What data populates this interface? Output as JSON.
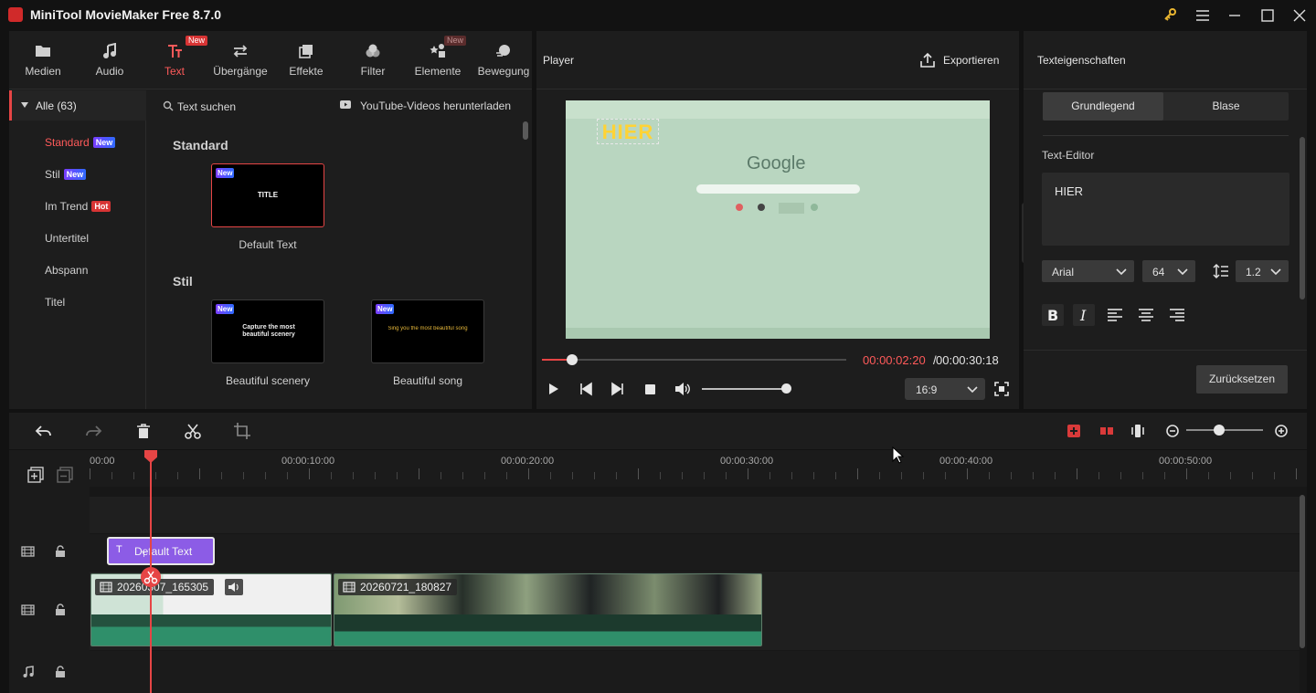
{
  "window": {
    "title": "MiniTool MovieMaker Free 8.7.0"
  },
  "media_tabs": [
    {
      "label": "Medien",
      "icon": "folder-icon"
    },
    {
      "label": "Audio",
      "icon": "music-note-icon"
    },
    {
      "label": "Text",
      "icon": "text-icon",
      "badge": "New",
      "active": true
    },
    {
      "label": "Übergänge",
      "icon": "transition-arrows-icon"
    },
    {
      "label": "Effekte",
      "icon": "effects-icon"
    },
    {
      "label": "Filter",
      "icon": "filter-icon"
    },
    {
      "label": "Elemente",
      "icon": "elements-icon",
      "badge": "New"
    },
    {
      "label": "Bewegung",
      "icon": "motion-icon"
    }
  ],
  "categories": {
    "all_label": "Alle (63)",
    "items": [
      {
        "label": "Standard",
        "badge": "New",
        "active": true
      },
      {
        "label": "Stil",
        "badge": "New"
      },
      {
        "label": "Im Trend",
        "badge": "Hot"
      },
      {
        "label": "Untertitel"
      },
      {
        "label": "Abspann"
      },
      {
        "label": "Titel"
      }
    ]
  },
  "text_library": {
    "search_label": "Text suchen",
    "youtube_label": "YouTube-Videos herunterladen",
    "sections": [
      {
        "title": "Standard",
        "items": [
          {
            "caption": "Default Text",
            "thumb_text": "TITLE",
            "badge": "New"
          }
        ]
      },
      {
        "title": "Stil",
        "items": [
          {
            "caption": "Beautiful scenery",
            "thumb_text": "Capture the most beautiful scenery",
            "badge": "New"
          },
          {
            "caption": "Beautiful song",
            "thumb_text": "Sing you the most beautiful song",
            "badge": "New"
          }
        ]
      }
    ]
  },
  "player": {
    "title": "Player",
    "export_label": "Exportieren",
    "overlay_text": "HIER",
    "preview_logo_text": "Google",
    "time_current": "00:00:02:20",
    "time_separator": " / ",
    "time_total": "00:00:30:18",
    "aspect_ratio": "16:9",
    "playback_progress": 0.1,
    "volume_level": 1.0
  },
  "properties": {
    "title": "Texteigenschaften",
    "tab_basic": "Grundlegend",
    "tab_bubble": "Blase",
    "editor_label": "Text-Editor",
    "editor_text": "HIER",
    "font": "Arial",
    "size": "64",
    "line_spacing": "1.2",
    "reset_label": "Zurücksetzen"
  },
  "timeline": {
    "ruler_labels": [
      "00:00",
      "00:00:10:00",
      "00:00:20:00",
      "00:00:30:00",
      "00:00:40:00",
      "00:00:50:00"
    ],
    "text_clip_label": "Default Text",
    "video_clips": [
      {
        "label": "20260307_165305"
      },
      {
        "label": "20260721_180827"
      }
    ],
    "zoom_level": 0.43
  },
  "colors": {
    "accent": "#e64545",
    "text_clip": "#8c5ce6",
    "audio_wave": "#2f8f6a"
  }
}
